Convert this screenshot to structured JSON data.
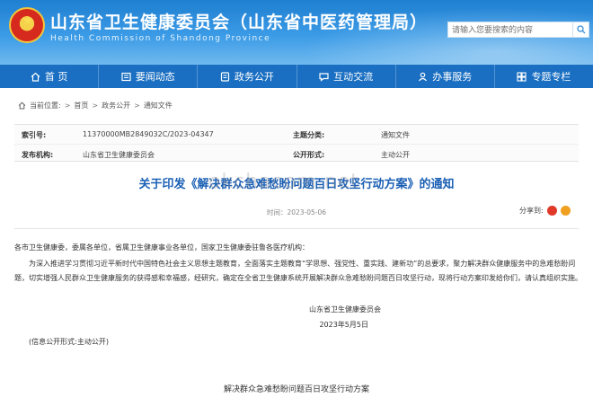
{
  "header": {
    "title": "山东省卫生健康委员会（山东省中医药管理局）",
    "subtitle": "Health Commission of Shandong Province",
    "search_placeholder": "请输入您要搜索的内容"
  },
  "nav": {
    "items": [
      {
        "label": "首 页",
        "icon": "home-icon"
      },
      {
        "label": "要闻动态",
        "icon": "news-icon"
      },
      {
        "label": "政务公开",
        "icon": "open-government-icon"
      },
      {
        "label": "互动交流",
        "icon": "chat-icon"
      },
      {
        "label": "办事服务",
        "icon": "service-icon"
      },
      {
        "label": "专题专栏",
        "icon": "topic-icon"
      }
    ]
  },
  "breadcrumb": {
    "prefix": "当前位置:",
    "items": [
      "首页",
      "政务公开",
      "通知文件"
    ],
    "separator": ">"
  },
  "meta": {
    "index_label": "索引号:",
    "index_value": "11370000MB2849032C/2023-04347",
    "category_label": "主题分类:",
    "category_value": "通知文件",
    "org_label": "发布机构:",
    "org_value": "山东省卫生健康委员会",
    "form_label": "公开形式:",
    "form_value": "主动公开"
  },
  "document": {
    "title": "关于印发《解决群众急难愁盼问题百日攻坚行动方案》的通知",
    "time": "时间：2023-05-06",
    "share_label": "分享到:",
    "salutation": "各市卫生健康委，委属各单位，省属卫生健康事业各单位，国家卫生健康委驻鲁各医疗机构：",
    "paragraph": "为深入推进学习贯彻习近平新时代中国特色社会主义思想主题教育，全面落实主题教育“学思想、强党性、重实践、建新功”的总要求，聚力解决群众健康服务中的急难愁盼问题，切实增强人民群众卫生健康服务的获得感和幸福感，经研究，确定在全省卫生健康系统开展解决群众急难愁盼问题百日攻坚行动，现将行动方案印发给你们，请认真组织实施。",
    "signature": "山东省卫生健康委员会",
    "date": "2023年5月5日",
    "disclosure": "(信息公开形式:主动公开)",
    "attachment_title": "解决群众急难愁盼问题百日攻坚行动方案"
  },
  "watermark": "okchacom.net",
  "colors": {
    "header_blue": "#1f7fd1",
    "nav_blue": "#1a6fc2",
    "title_blue": "#1a5fb4",
    "weibo_red": "#e0392a",
    "wechat_orange": "#f0a020"
  }
}
